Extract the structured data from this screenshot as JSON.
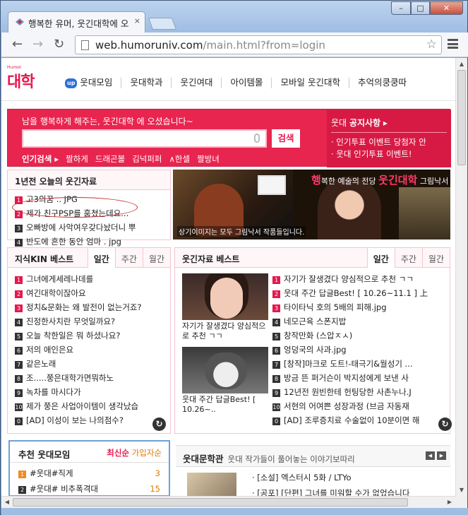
{
  "browser": {
    "tab_title": "행복한 유머, 웃긴대학에 오",
    "tab_close": "×",
    "win_min": "–",
    "win_max": "□",
    "win_close": "✕",
    "back": "←",
    "forward": "→",
    "reload": "↻",
    "url_host": "web.humoruniv.com",
    "url_path": "/main.html?from=login",
    "star": "☆"
  },
  "site": {
    "logo": "대학",
    "logo_sub": "Humor",
    "gnb": {
      "up_badge": "up",
      "items": [
        "웃대모임",
        "웃대학과",
        "웃긴여대",
        "아이템몰",
        "모바일 웃긴대학",
        "추억의쿵쿵따"
      ]
    }
  },
  "search": {
    "greeting": "남을 행복하게 해주는, 웃긴대학 에 오셨습니다~",
    "button": "검색",
    "hot_title": "인기검색 ▸",
    "hot_keywords": [
      "짤하게",
      "드래곤볼",
      "김넉퍼퍼",
      "∧한셀",
      "짤방녀"
    ],
    "notice_title_prefix": "웃대 ",
    "notice_title": "공지사항",
    "notice_arrow": " ▸",
    "notices": [
      "· 인기투표 이벤트 당첨자 안",
      "· 웃대 인기투표 이벤트!"
    ]
  },
  "today": {
    "title": "1년전 오늘의 웃긴자료",
    "items": [
      {
        "num": "1",
        "text": "고3의꿈 .. JPG"
      },
      {
        "num": "2",
        "text": "제가 친구PSP를 훔쳤는데요..."
      },
      {
        "num": "3",
        "text": "오빠방에 사악여우갖다놨더니 뿌"
      },
      {
        "num": "4",
        "text": "반도에 흔한 동안 엄마 . jpg"
      }
    ]
  },
  "banner": {
    "lead": "행",
    "text1": "복한 예술의 전당 ",
    "brand": "웃긴대학",
    "text2": " 그림낙서",
    "caption": "상기이미지는 모두 그림낙서 작품들입니다."
  },
  "kin": {
    "title": "지식KIN 베스트",
    "tabs": [
      "일간",
      "주간",
      "월간"
    ],
    "more": "↻",
    "items": [
      {
        "num": "1",
        "text": "그녀에게세레나데를"
      },
      {
        "num": "2",
        "text": "여긴대학이잖아요"
      },
      {
        "num": "3",
        "text": "정치&문화는 왜 발전이 없는거죠?"
      },
      {
        "num": "4",
        "text": "진정한사치란 무엇일까요?"
      },
      {
        "num": "5",
        "text": "오늘 착한일은 뭐 하셨나요?"
      },
      {
        "num": "6",
        "text": "저의 애인은요"
      },
      {
        "num": "7",
        "text": "같은노래"
      },
      {
        "num": "8",
        "text": "조.....쭝은대학가면뭐하노"
      },
      {
        "num": "9",
        "text": "녹차를 마시다가"
      },
      {
        "num": "10",
        "text": "제가 쭝은 사업아이템이 생각났습"
      },
      {
        "num": "0",
        "text": "[AD] 이성이 보는 나의점수?"
      }
    ]
  },
  "best": {
    "title": "웃긴자료 베스트",
    "tabs": [
      "일간",
      "주간",
      "월간"
    ],
    "more": "↻",
    "thumb1_caption": "자기가 잘생겼다 양심적으로 추천 ㄱㄱ",
    "thumb2_caption": "웃대 주간 답글Best! [ 10.26~..",
    "items": [
      {
        "num": "1",
        "text": "자기가 잘생겼다 양심적으로 추천 ㄱㄱ"
      },
      {
        "num": "2",
        "text": "웃대 주간 답글Best! [ 10.26~11.1 ] 上"
      },
      {
        "num": "3",
        "text": "타이타닉 호의 5배의 피해.jpg"
      },
      {
        "num": "4",
        "text": "네모근육 스폰지밥"
      },
      {
        "num": "5",
        "text": "창작만화 (스압ㅈㅅ)"
      },
      {
        "num": "6",
        "text": "엉덩국의 사과.jpg"
      },
      {
        "num": "7",
        "text": "[창작]마크로 도트!-태극기&월성기 ..."
      },
      {
        "num": "8",
        "text": "방금 뜬 퍼거슨이 박지성에게 보낸 사"
      },
      {
        "num": "9",
        "text": "12년전 원빈한테 헌팅당한 사촌누나.J"
      },
      {
        "num": "10",
        "text": "서현의 어여쁜 성장과정 (브금 자동재"
      },
      {
        "num": "0",
        "text": "[AD] 조루증치료 수술없이 10분이면 해"
      }
    ]
  },
  "recommend": {
    "title": "추천 웃대모임",
    "sort_active": "최신순",
    "sort_other": " 가입자순",
    "items": [
      {
        "num": "1",
        "text": "#웃대#직게",
        "count": "3"
      },
      {
        "num": "2",
        "text": "#웃대# 비추폭격대",
        "count": "15"
      }
    ]
  },
  "literature": {
    "title": "웃대문학관",
    "subtitle": "웃대 작가들이 풀어놓는 이야기보따리",
    "prev": "◀",
    "next": "▶",
    "items": [
      "· [소설] 엑스터시 5화 / LTYo",
      "· [공포] [단편] 그녀를 미워할 수가 없었습니다"
    ]
  },
  "colors": {
    "brand": "#e5184d",
    "accent_orange": "#e07b00",
    "annotation": "#c9302c"
  }
}
